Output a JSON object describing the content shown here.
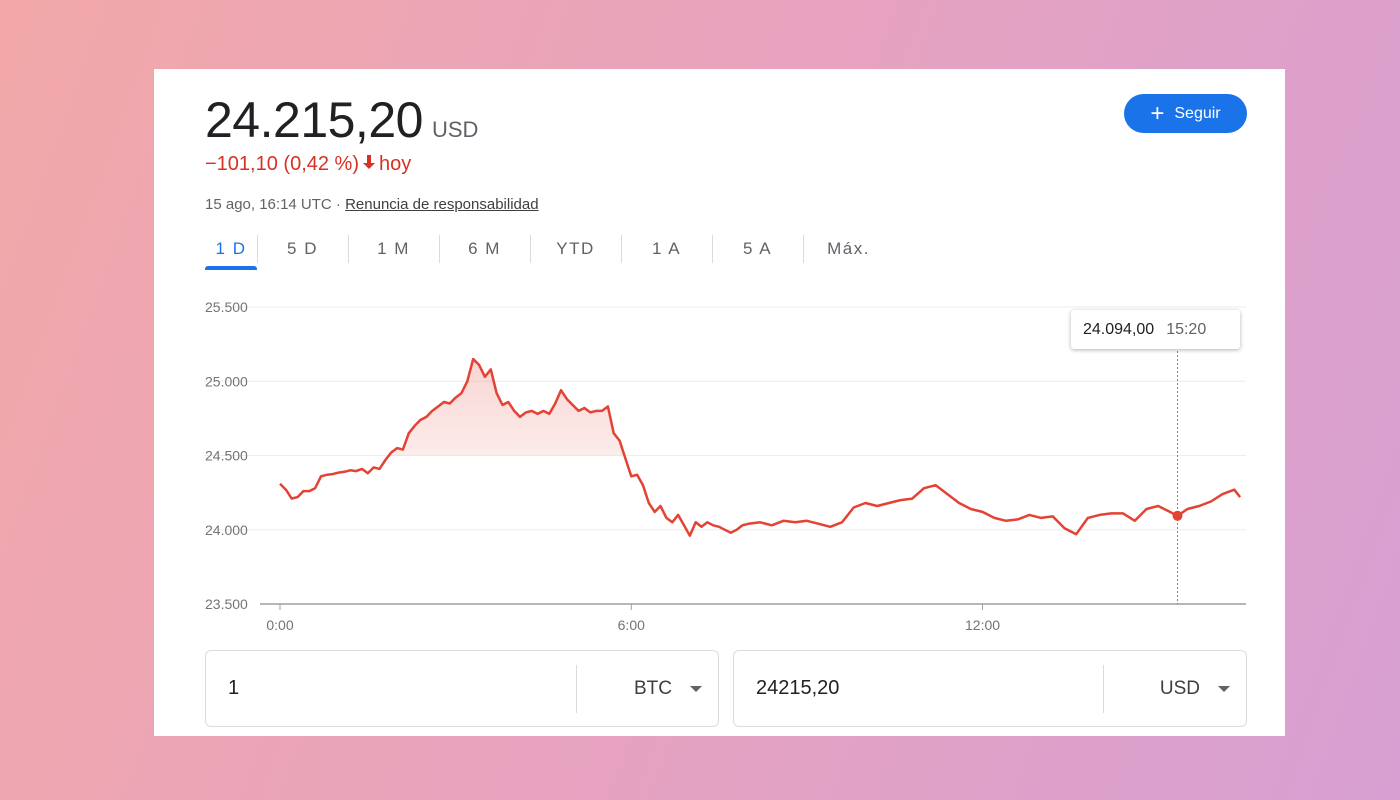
{
  "quote": {
    "price": "24.215,20",
    "currency": "USD",
    "change": "−101,10 (0,42 %)",
    "change_arrow": "arrow-down-icon",
    "change_period": "hoy",
    "timestamp": "15 ago, 16:14 UTC ·",
    "disclaimer": "Renuncia de responsabilidad"
  },
  "follow_button": {
    "label": "Seguir",
    "icon": "plus-icon"
  },
  "tabs": [
    {
      "label": "1 D",
      "active": true
    },
    {
      "label": "5 D",
      "active": false
    },
    {
      "label": "1 M",
      "active": false
    },
    {
      "label": "6 M",
      "active": false
    },
    {
      "label": "YTD",
      "active": false
    },
    {
      "label": "1 A",
      "active": false
    },
    {
      "label": "5 A",
      "active": false
    },
    {
      "label": "Máx.",
      "active": false
    }
  ],
  "tooltip": {
    "value": "24.094,00",
    "time": "15:20"
  },
  "converter": {
    "from_amount": "1",
    "from_unit": "BTC",
    "to_amount": "24215,20",
    "to_unit": "USD"
  },
  "colors": {
    "line": "#e34234",
    "accent": "#1a73e8",
    "negative": "#d93025"
  },
  "chart_data": {
    "type": "line",
    "x_unit": "hours",
    "xlim": [
      0,
      16.5
    ],
    "ylim": [
      23500,
      25500
    ],
    "y_ticks": [
      25500,
      25000,
      24500,
      24000,
      23500
    ],
    "y_tick_labels": [
      "25.500",
      "25.000",
      "24.500",
      "24.000",
      "23.500"
    ],
    "x_ticks": [
      0,
      6,
      12
    ],
    "x_tick_labels": [
      "0:00",
      "6:00",
      "12:00"
    ],
    "marker": {
      "x": 15.33,
      "y": 24094
    },
    "series": [
      {
        "x": [
          0,
          0.1,
          0.2,
          0.3,
          0.4,
          0.5,
          0.6,
          0.7,
          0.8,
          0.9,
          1.0,
          1.1,
          1.2,
          1.3,
          1.4,
          1.5,
          1.6,
          1.7,
          1.8,
          1.9,
          2.0,
          2.1,
          2.2,
          2.3,
          2.4,
          2.5,
          2.6,
          2.7,
          2.8,
          2.9,
          3.0,
          3.1,
          3.2,
          3.3,
          3.4,
          3.5,
          3.6,
          3.7,
          3.8,
          3.9,
          4.0,
          4.1,
          4.2,
          4.3,
          4.4,
          4.5,
          4.6,
          4.7,
          4.8,
          4.9,
          5.0,
          5.1,
          5.2,
          5.3,
          5.4,
          5.5,
          5.6,
          5.7,
          5.8,
          5.9,
          6.0,
          6.1,
          6.2,
          6.3,
          6.4,
          6.5,
          6.6,
          6.7,
          6.8,
          6.9,
          7.0,
          7.1,
          7.2,
          7.3,
          7.4,
          7.5,
          7.6,
          7.7,
          7.8,
          7.9,
          8.0,
          8.2,
          8.4,
          8.6,
          8.8,
          9.0,
          9.2,
          9.4,
          9.6,
          9.8,
          10.0,
          10.2,
          10.4,
          10.6,
          10.8,
          11.0,
          11.2,
          11.4,
          11.6,
          11.8,
          12.0,
          12.2,
          12.4,
          12.6,
          12.8,
          13.0,
          13.2,
          13.4,
          13.6,
          13.8,
          14.0,
          14.2,
          14.4,
          14.6,
          14.8,
          15.0,
          15.2,
          15.33,
          15.5,
          15.7,
          15.9,
          16.1,
          16.3,
          16.4
        ],
        "y": [
          24310,
          24270,
          24210,
          24220,
          24260,
          24260,
          24280,
          24360,
          24370,
          24375,
          24385,
          24390,
          24400,
          24395,
          24410,
          24380,
          24420,
          24410,
          24470,
          24520,
          24550,
          24540,
          24650,
          24700,
          24740,
          24760,
          24800,
          24830,
          24860,
          24850,
          24890,
          24920,
          25000,
          25150,
          25110,
          25030,
          25080,
          24920,
          24840,
          24860,
          24800,
          24760,
          24790,
          24800,
          24780,
          24800,
          24780,
          24850,
          24940,
          24880,
          24840,
          24800,
          24820,
          24790,
          24800,
          24800,
          24830,
          24650,
          24600,
          24480,
          24360,
          24370,
          24300,
          24180,
          24120,
          24160,
          24080,
          24050,
          24100,
          24030,
          23960,
          24050,
          24020,
          24050,
          24030,
          24020,
          24000,
          23980,
          24000,
          24030,
          24040,
          24050,
          24030,
          24060,
          24050,
          24060,
          24040,
          24020,
          24050,
          24150,
          24180,
          24160,
          24180,
          24200,
          24210,
          24280,
          24300,
          24240,
          24180,
          24140,
          24120,
          24080,
          24060,
          24070,
          24100,
          24080,
          24090,
          24010,
          23970,
          24080,
          24100,
          24110,
          24110,
          24060,
          24140,
          24160,
          24120,
          24094,
          24140,
          24160,
          24190,
          24240,
          24270,
          24220
        ]
      }
    ]
  }
}
